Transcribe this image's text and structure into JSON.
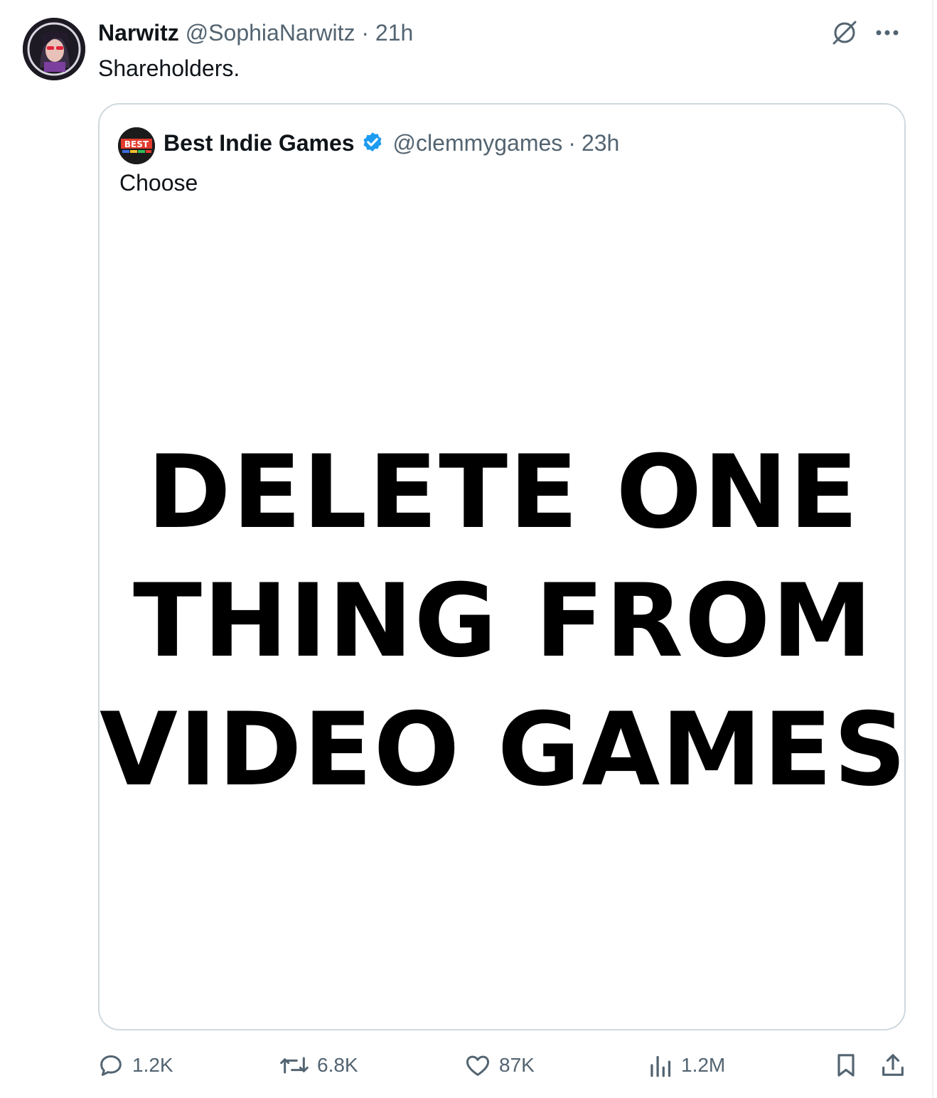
{
  "post": {
    "author_name": "Narwitz",
    "handle": "@SophiaNarwitz",
    "separator": "·",
    "time": "21h",
    "text": "Shareholders."
  },
  "top_icons": [
    "grok-icon",
    "more-icon"
  ],
  "quoted": {
    "author_name": "Best Indie Games",
    "verified": true,
    "handle": "@clemmygames",
    "separator": "·",
    "time": "23h",
    "text": "Choose",
    "avatar_logo_text": "BEST",
    "media_headline_lines": [
      "DELETE ONE",
      "THING FROM",
      "VIDEO GAMES"
    ]
  },
  "actions": {
    "replies": "1.2K",
    "reposts": "6.8K",
    "likes": "87K",
    "views": "1.2M"
  },
  "colors": {
    "text": "#0f1419",
    "muted": "#536471",
    "border": "#cfd9de",
    "verified": "#1d9bf0"
  }
}
